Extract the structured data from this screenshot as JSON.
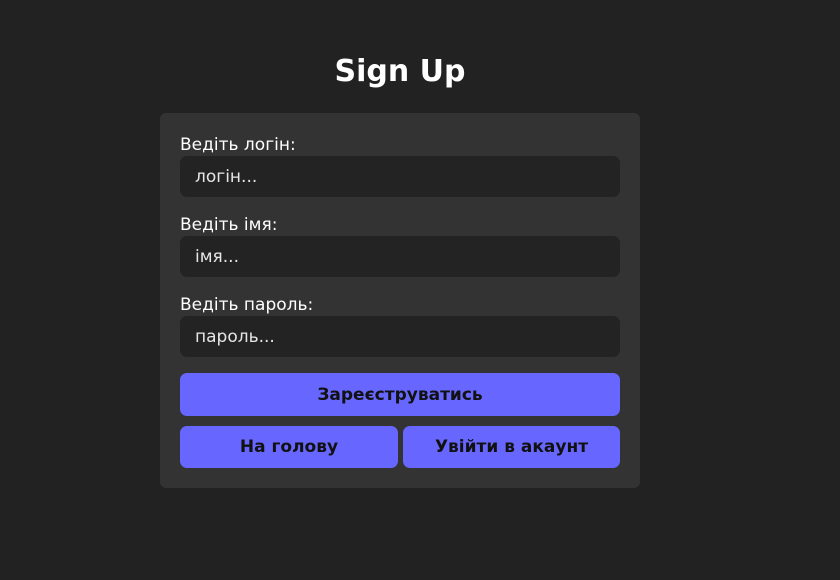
{
  "page": {
    "title": "Sign Up"
  },
  "form": {
    "login": {
      "label": "Ведіть логін:",
      "placeholder": "логін...",
      "value": ""
    },
    "name": {
      "label": "Ведіть імя:",
      "placeholder": "імя...",
      "value": ""
    },
    "password": {
      "label": "Ведіть пароль:",
      "placeholder": "пароль...",
      "value": ""
    },
    "register_label": "Зареєструватись",
    "home_label": "На голову",
    "login_label": "Увійти в акаунт"
  },
  "colors": {
    "background": "#222222",
    "card": "#333333",
    "input": "#232323",
    "accent": "#6767ff"
  }
}
